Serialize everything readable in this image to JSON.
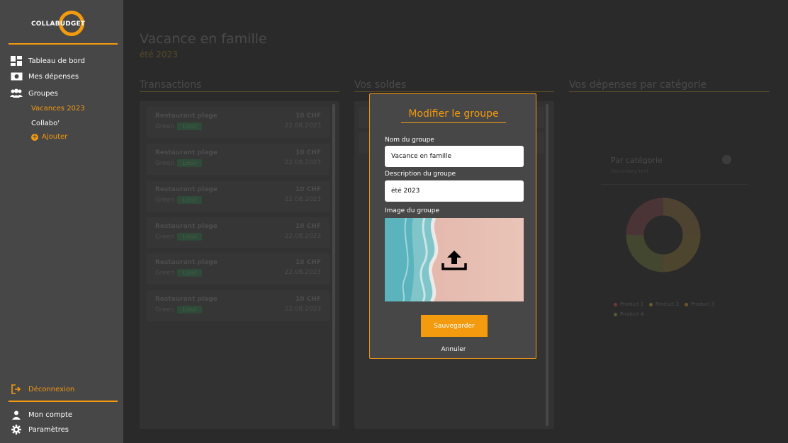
{
  "app": {
    "logo_text": "COLLABUDGET"
  },
  "sidebar": {
    "items": [
      {
        "label": "Tableau de bord",
        "icon": "dashboard-icon"
      },
      {
        "label": "Mes dépenses",
        "icon": "money-icon"
      },
      {
        "label": "Groupes",
        "icon": "groups-icon"
      }
    ],
    "groups": [
      {
        "label": "Vacances 2023",
        "active": true
      },
      {
        "label": "Collabo'",
        "active": false
      }
    ],
    "add_label": "Ajouter",
    "logout_label": "Déconnexion",
    "account_label": "Mon compte",
    "settings_label": "Paramètres"
  },
  "main": {
    "title": "Vacance en famille",
    "subtitle": "été 2023",
    "sections": {
      "transactions": "Transactions",
      "balances": "Vos soldes",
      "categories": "Vos dépenses par catégorie"
    },
    "transactions": [
      {
        "name": "Restaurant plage",
        "payer": "Green",
        "tag": "Loisir",
        "amount": "10 CHF",
        "date": "22.08.2023"
      },
      {
        "name": "Restaurant plage",
        "payer": "Green",
        "tag": "Loisir",
        "amount": "10 CHF",
        "date": "22.08.2023"
      },
      {
        "name": "Restaurant plage",
        "payer": "Green",
        "tag": "Loisir",
        "amount": "10 CHF",
        "date": "22.08.2023"
      },
      {
        "name": "Restaurant plage",
        "payer": "Green",
        "tag": "Loisir",
        "amount": "10 CHF",
        "date": "22.08.2023"
      },
      {
        "name": "Restaurant plage",
        "payer": "Green",
        "tag": "Loisir",
        "amount": "10 CHF",
        "date": "22.08.2023"
      },
      {
        "name": "Restaurant plage",
        "payer": "Green",
        "tag": "Loisir",
        "amount": "10 CHF",
        "date": "22.08.2023"
      }
    ],
    "category_card": {
      "title": "Par catégorie",
      "subtitle": "Secondary text",
      "legend": [
        "Product 1",
        "Product 2",
        "Product 3",
        "Product 4"
      ],
      "legend_colors": [
        "#6b3a3a",
        "#6b5a30",
        "#6e5526",
        "#4f5f30"
      ]
    }
  },
  "modal": {
    "title": "Modifier le groupe",
    "name_label": "Nom du groupe",
    "name_value": "Vacance en famille",
    "description_label": "Description du groupe",
    "description_value": "été 2023",
    "image_label": "Image du groupe",
    "save_label": "Sauvegarder",
    "cancel_label": "Annuler"
  },
  "colors": {
    "accent": "#f39a0e",
    "sidebar_bg": "#474747",
    "background": "#2a2a2a"
  }
}
